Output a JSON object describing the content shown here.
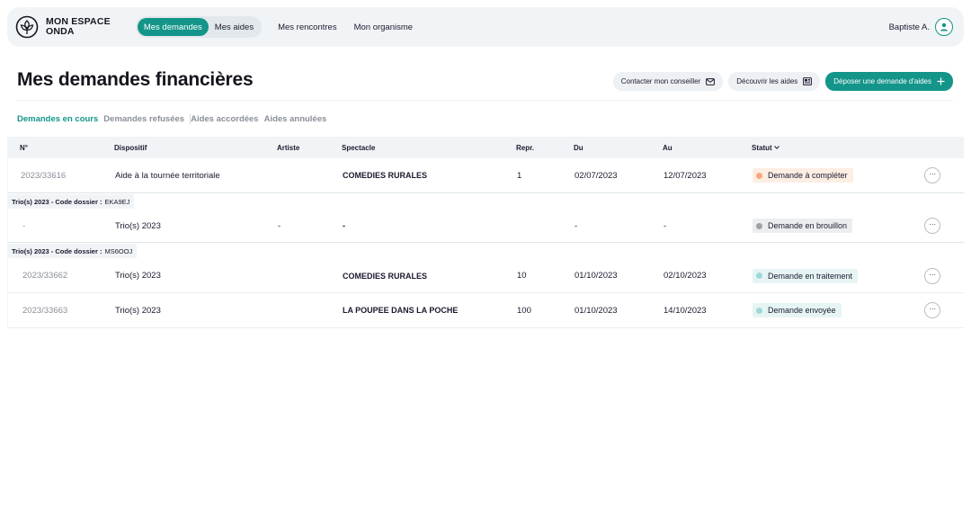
{
  "app": {
    "logo_line1": "MON ESPACE",
    "logo_line2": "ONDA",
    "user_name": "Baptiste A."
  },
  "nav": {
    "items": [
      {
        "label": "Mes demandes",
        "active": true
      },
      {
        "label": "Mes aides",
        "active": false
      },
      {
        "label": "Mes rencontres",
        "active": false
      },
      {
        "label": "Mon organisme",
        "active": false
      }
    ]
  },
  "page": {
    "title": "Mes demandes financières"
  },
  "actions": {
    "contact_label": "Contacter mon conseiller",
    "discover_label": "Découvrir les aides",
    "submit_label": "Déposer une demande d'aides"
  },
  "tabs": [
    {
      "label": "Demandes en cours",
      "active": true
    },
    {
      "label": "Demandes refusées",
      "active": false
    },
    {
      "label": "Aides accordées",
      "active": false
    },
    {
      "label": "Aides annulées",
      "active": false
    }
  ],
  "table": {
    "columns": {
      "num": "N°",
      "dispositif": "Dispositif",
      "artiste": "Artiste",
      "spectacle": "Spectacle",
      "repr": "Repr.",
      "du": "Du",
      "au": "Au",
      "statut": "Statut",
      "statut_sort_icon": "caret-down-icon"
    },
    "rows": [
      {
        "num": "2023/33616",
        "dispositif": "Aide à la tournée territoriale",
        "artiste": "",
        "spectacle": "COMEDIES RURALES",
        "repr": "1",
        "du": "02/07/2023",
        "au": "12/07/2023",
        "status": "Demande à compléter",
        "status_color": "#f7a97c",
        "status_bg": "#fdeee4"
      }
    ],
    "groups": [
      {
        "label_bold": "Trio(s) 2023 - Code dossier :",
        "code": "EKA9EJ",
        "row": {
          "num": "-",
          "dispositif": "Trio(s) 2023",
          "artiste": "-",
          "spectacle": "-",
          "repr": "",
          "du": "-",
          "au": "-",
          "status": "Demande en brouillon",
          "status_color": "#9ea2a8",
          "status_bg": "#ebedef"
        }
      },
      {
        "label_bold": "Trio(s) 2023 - Code dossier :",
        "code": "MS6OOJ",
        "rows": [
          {
            "num": "2023/33662",
            "dispositif": "Trio(s) 2023",
            "artiste": "",
            "spectacle": "COMEDIES RURALES",
            "repr": "10",
            "du": "01/10/2023",
            "au": "02/10/2023",
            "status": "Demande en traitement",
            "status_color": "#9fd8d8",
            "status_bg": "#e6f5f4"
          },
          {
            "num": "2023/33663",
            "dispositif": "Trio(s) 2023",
            "artiste": "",
            "spectacle": "LA POUPEE DANS LA POCHE",
            "repr": "100",
            "du": "01/10/2023",
            "au": "14/10/2023",
            "status": "Demande envoyée",
            "status_color": "#9fd8d8",
            "status_bg": "#e6f5f4"
          }
        ]
      }
    ],
    "row_menu_label": "···"
  },
  "colors": {
    "accent": "#13958a",
    "muted_text": "#8a8f98"
  }
}
